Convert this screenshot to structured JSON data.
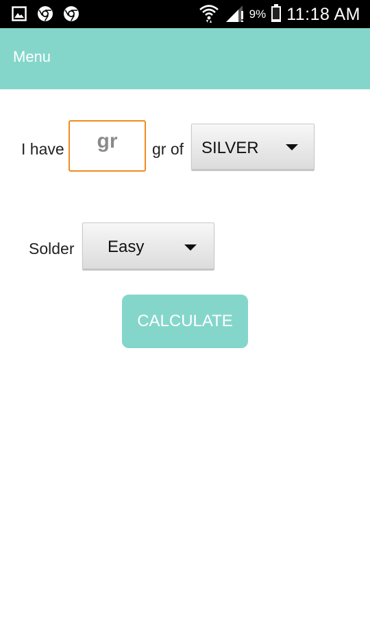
{
  "status_bar": {
    "battery_percent": "9%",
    "time": "11:18 AM",
    "left_icons": [
      "gallery-icon",
      "chrome-icon",
      "chrome-icon"
    ],
    "right_icons": [
      "wifi-icon",
      "signal-icon",
      "battery-icon"
    ]
  },
  "toolbar": {
    "menu_label": "Menu"
  },
  "form": {
    "have_label": "I have",
    "grams_placeholder": "gr",
    "grams_value": "",
    "of_label": "gr of",
    "metal_selected": "SILVER",
    "solder_label": "Solder",
    "solder_selected": "Easy",
    "calculate_label": "CALCULATE"
  },
  "colors": {
    "accent": "#84d6cb",
    "focus_border": "#f08a1c",
    "status_bar": "#000000"
  }
}
